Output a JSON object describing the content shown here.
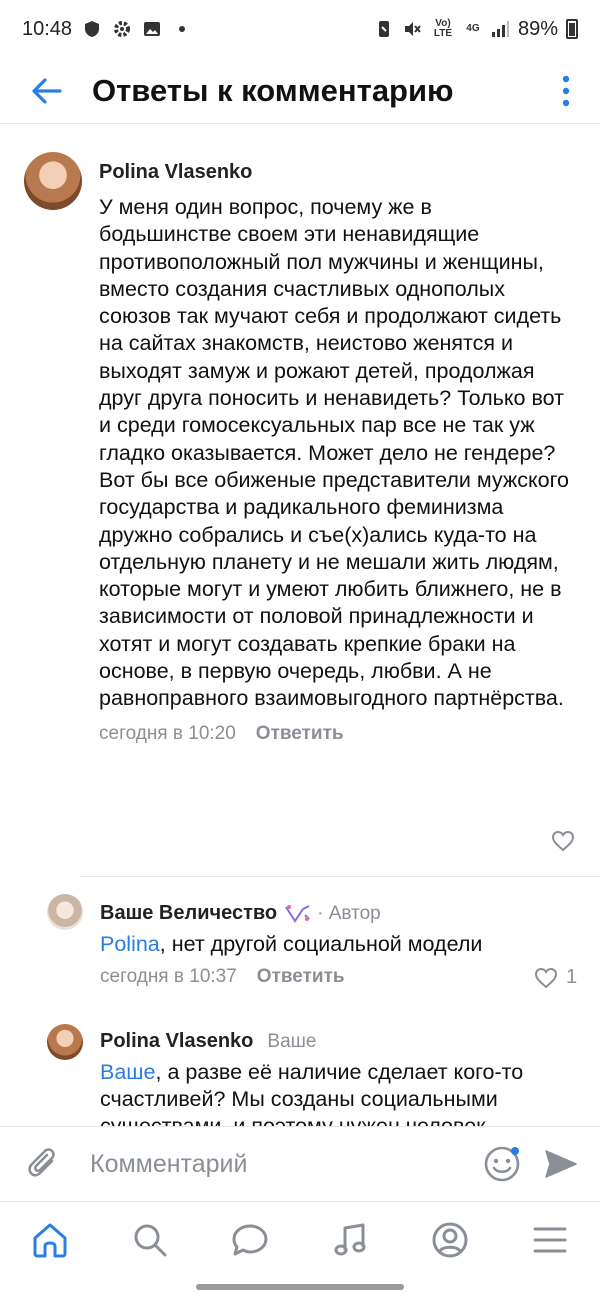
{
  "status_bar": {
    "time": "10:48",
    "lte": "Vo) LTE",
    "network": "4G",
    "battery": "89%"
  },
  "header": {
    "title": "Ответы к комментарию"
  },
  "main_comment": {
    "author": "Polina Vlasenko",
    "text": "У меня один вопрос, почему же в бодьшинстве своем эти ненавидящие противоположный пол мужчины и женщины, вместо создания счастливых однополых союзов так мучают себя и продолжают сидеть на сайтах знакомств, неистово женятся и выходят замуж и рожают детей, продолжая друг друга поносить и ненавидеть? Только вот и среди гомосексуальных пар все не так уж гладко оказывается. Может дело не гендере? Вот бы все обиженые представители мужского государства и радикального феминизма дружно собрались и съе(х)ались куда-то на отдельную планету и не мешали жить людям, которые могут и умеют любить ближнего, не в зависимости от половой принадлежности и хотят и могут создавать крепкие браки на основе, в первую очередь, любви. А не равноправного взаимовыгодного партнёрства.",
    "time": "сегодня в 10:20",
    "reply_label": "Ответить"
  },
  "replies": [
    {
      "author": "Ваше Величество",
      "author_tag": "· Автор",
      "mention": "Polina",
      "text": ", нет другой социальной модели",
      "time": "сегодня в 10:37",
      "reply_label": "Ответить",
      "likes": "1"
    },
    {
      "author": "Polina Vlasenko",
      "author_tag": "Ваше",
      "mention": "Ваше",
      "text": ", а разве её наличие сделает кого-то счастливей? Мы созданы социальными существами, и поэтому нужен человек"
    }
  ],
  "composer": {
    "placeholder": "Комментарий"
  },
  "tabs": [
    "home",
    "search",
    "messages",
    "music",
    "profile",
    "menu"
  ],
  "colors": {
    "accent": "#2a7de1",
    "muted": "#8a8f96"
  }
}
